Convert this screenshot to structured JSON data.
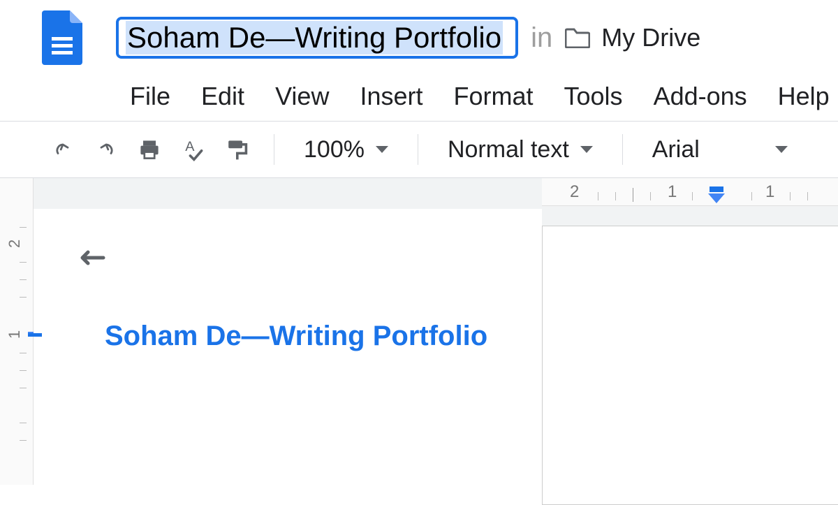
{
  "header": {
    "title": "Soham De—Writing Portfolio",
    "location_prefix": "in",
    "drive_label": "My Drive"
  },
  "menu": {
    "items": [
      "File",
      "Edit",
      "View",
      "Insert",
      "Format",
      "Tools",
      "Add-ons",
      "Help"
    ]
  },
  "toolbar": {
    "zoom": "100%",
    "style": "Normal text",
    "font": "Arial"
  },
  "outline": {
    "title": "Soham De—Writing Portfolio"
  },
  "ruler": {
    "h": [
      "2",
      "1",
      "1"
    ],
    "v": [
      "2",
      "1"
    ]
  }
}
